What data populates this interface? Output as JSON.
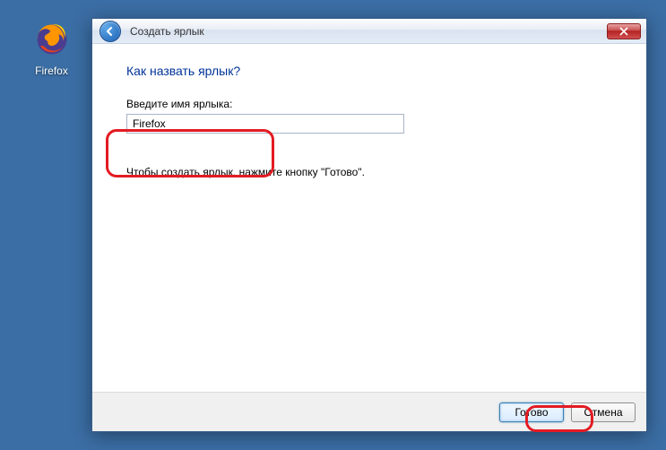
{
  "desktop": {
    "icon_label": "Firefox"
  },
  "dialog": {
    "titlebar": "Создать ярлык",
    "heading": "Как назвать ярлык?",
    "field_label": "Введите имя ярлыка:",
    "input_value": "Firefox",
    "hint": "Чтобы создать ярлык, нажмите кнопку \"Готово\".",
    "buttons": {
      "finish": "Готово",
      "cancel": "Отмена"
    }
  }
}
